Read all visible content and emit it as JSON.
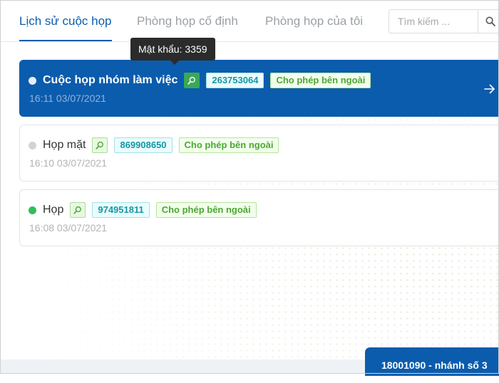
{
  "tabs": [
    {
      "label": "Lịch sử cuộc họp",
      "active": true
    },
    {
      "label": "Phòng họp cố định",
      "active": false
    },
    {
      "label": "Phòng họp của tôi",
      "active": false
    }
  ],
  "search": {
    "placeholder": "Tìm kiếm ...",
    "value": ""
  },
  "tooltip": {
    "text": "Mật khẩu: 3359"
  },
  "meetings": [
    {
      "title": "Cuộc họp nhóm làm việc",
      "code": "263753064",
      "tag": "Cho phép bên ngoài",
      "time": "16:11 03/07/2021",
      "status_color": "#e9eef6",
      "active": true
    },
    {
      "title": "Họp mặt",
      "code": "869908650",
      "tag": "Cho phép bên ngoài",
      "time": "16:10 03/07/2021",
      "status_color": "#d3d3d3",
      "active": false
    },
    {
      "title": "Họp",
      "code": "974951811",
      "tag": "Cho phép bên ngoài",
      "time": "16:08 03/07/2021",
      "status_color": "#2fbf5a",
      "active": false
    }
  ],
  "hotline": {
    "text": "18001090 - nhánh số 3"
  },
  "colors": {
    "primary": "#0b5cad",
    "online": "#2fbf5a",
    "tag_green": "#4ea635",
    "code_teal": "#1597a3"
  },
  "icons": {
    "search": "magnifier-icon",
    "arrow": "arrow-right-icon",
    "password": "key-search-icon"
  }
}
